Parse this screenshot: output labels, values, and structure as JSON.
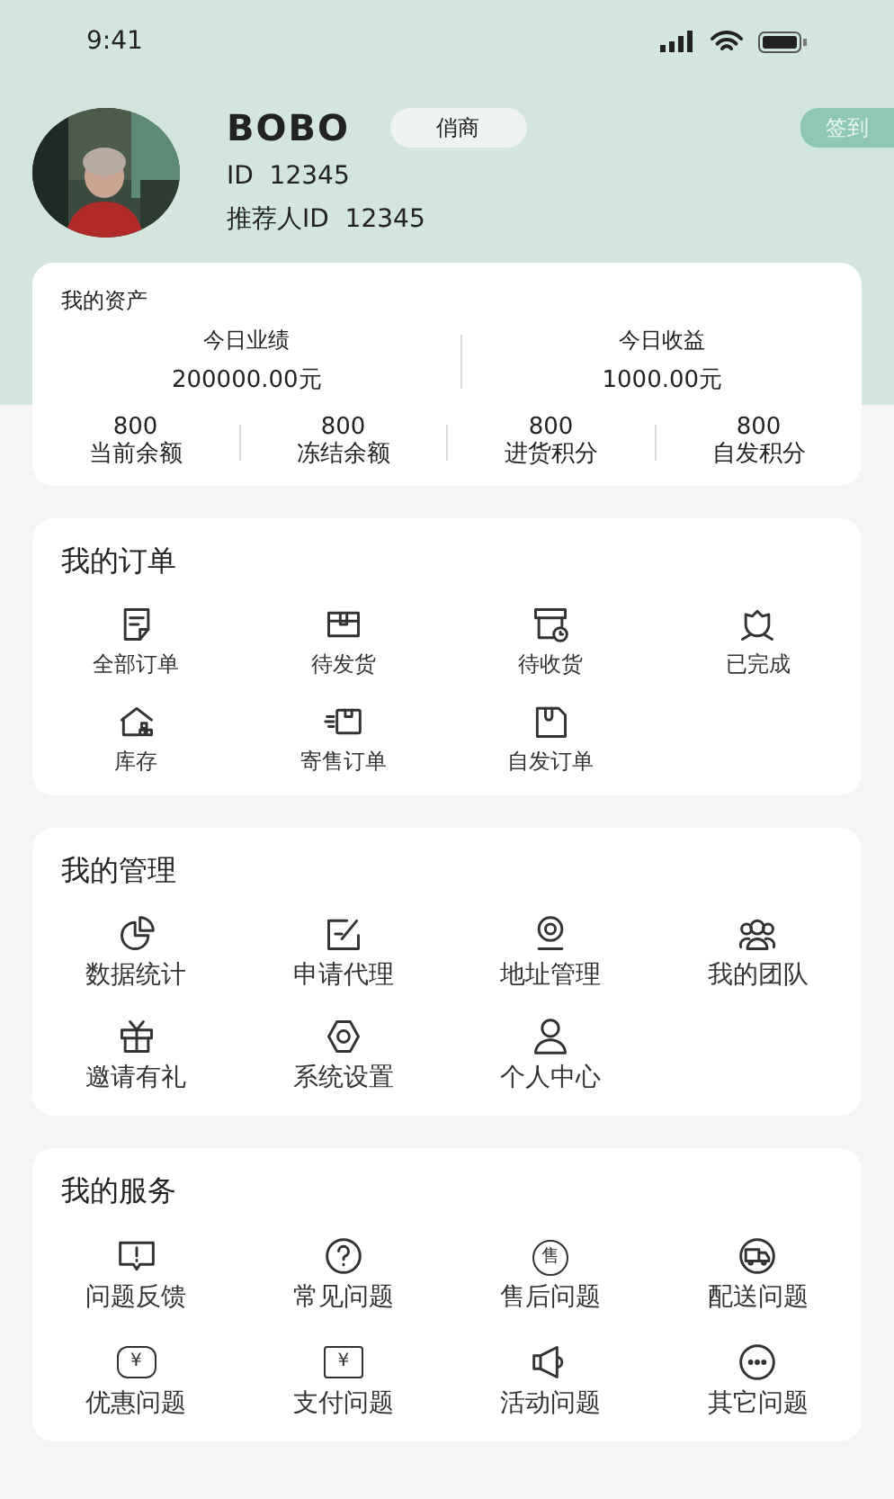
{
  "status_bar": {
    "time": "9:41"
  },
  "profile": {
    "name": "BOBO",
    "role_tag": "俏商",
    "id_line": "ID  12345",
    "referrer_line": "推荐人ID  12345",
    "checkin_button": "签到"
  },
  "assets": {
    "title": "我的资产",
    "main": [
      {
        "label": "今日业绩",
        "value": "200000.00元"
      },
      {
        "label": "今日收益",
        "value": "1000.00元"
      }
    ],
    "stats": [
      {
        "value": "800",
        "label": "当前余额"
      },
      {
        "value": "800",
        "label": "冻结余额"
      },
      {
        "value": "800",
        "label": "进货积分"
      },
      {
        "value": "800",
        "label": "自发积分"
      }
    ]
  },
  "sections": [
    {
      "title": "我的订单",
      "items": [
        {
          "label": "全部订单"
        },
        {
          "label": "待发货"
        },
        {
          "label": "待收货"
        },
        {
          "label": "已完成"
        },
        {
          "label": "库存"
        },
        {
          "label": "寄售订单"
        },
        {
          "label": "自发订单"
        }
      ]
    },
    {
      "title": "我的管理",
      "items": [
        {
          "label": "数据统计"
        },
        {
          "label": "申请代理"
        },
        {
          "label": "地址管理"
        },
        {
          "label": "我的团队"
        },
        {
          "label": "邀请有礼"
        },
        {
          "label": "系统设置"
        },
        {
          "label": "个人中心"
        }
      ]
    },
    {
      "title": "我的服务",
      "items": [
        {
          "label": "问题反馈"
        },
        {
          "label": "常见问题"
        },
        {
          "label": "售后问题",
          "glyph": "售"
        },
        {
          "label": "配送问题"
        },
        {
          "label": "优惠问题",
          "glyph": "¥"
        },
        {
          "label": "支付问题",
          "glyph": "¥"
        },
        {
          "label": "活动问题"
        },
        {
          "label": "其它问题"
        }
      ]
    }
  ]
}
